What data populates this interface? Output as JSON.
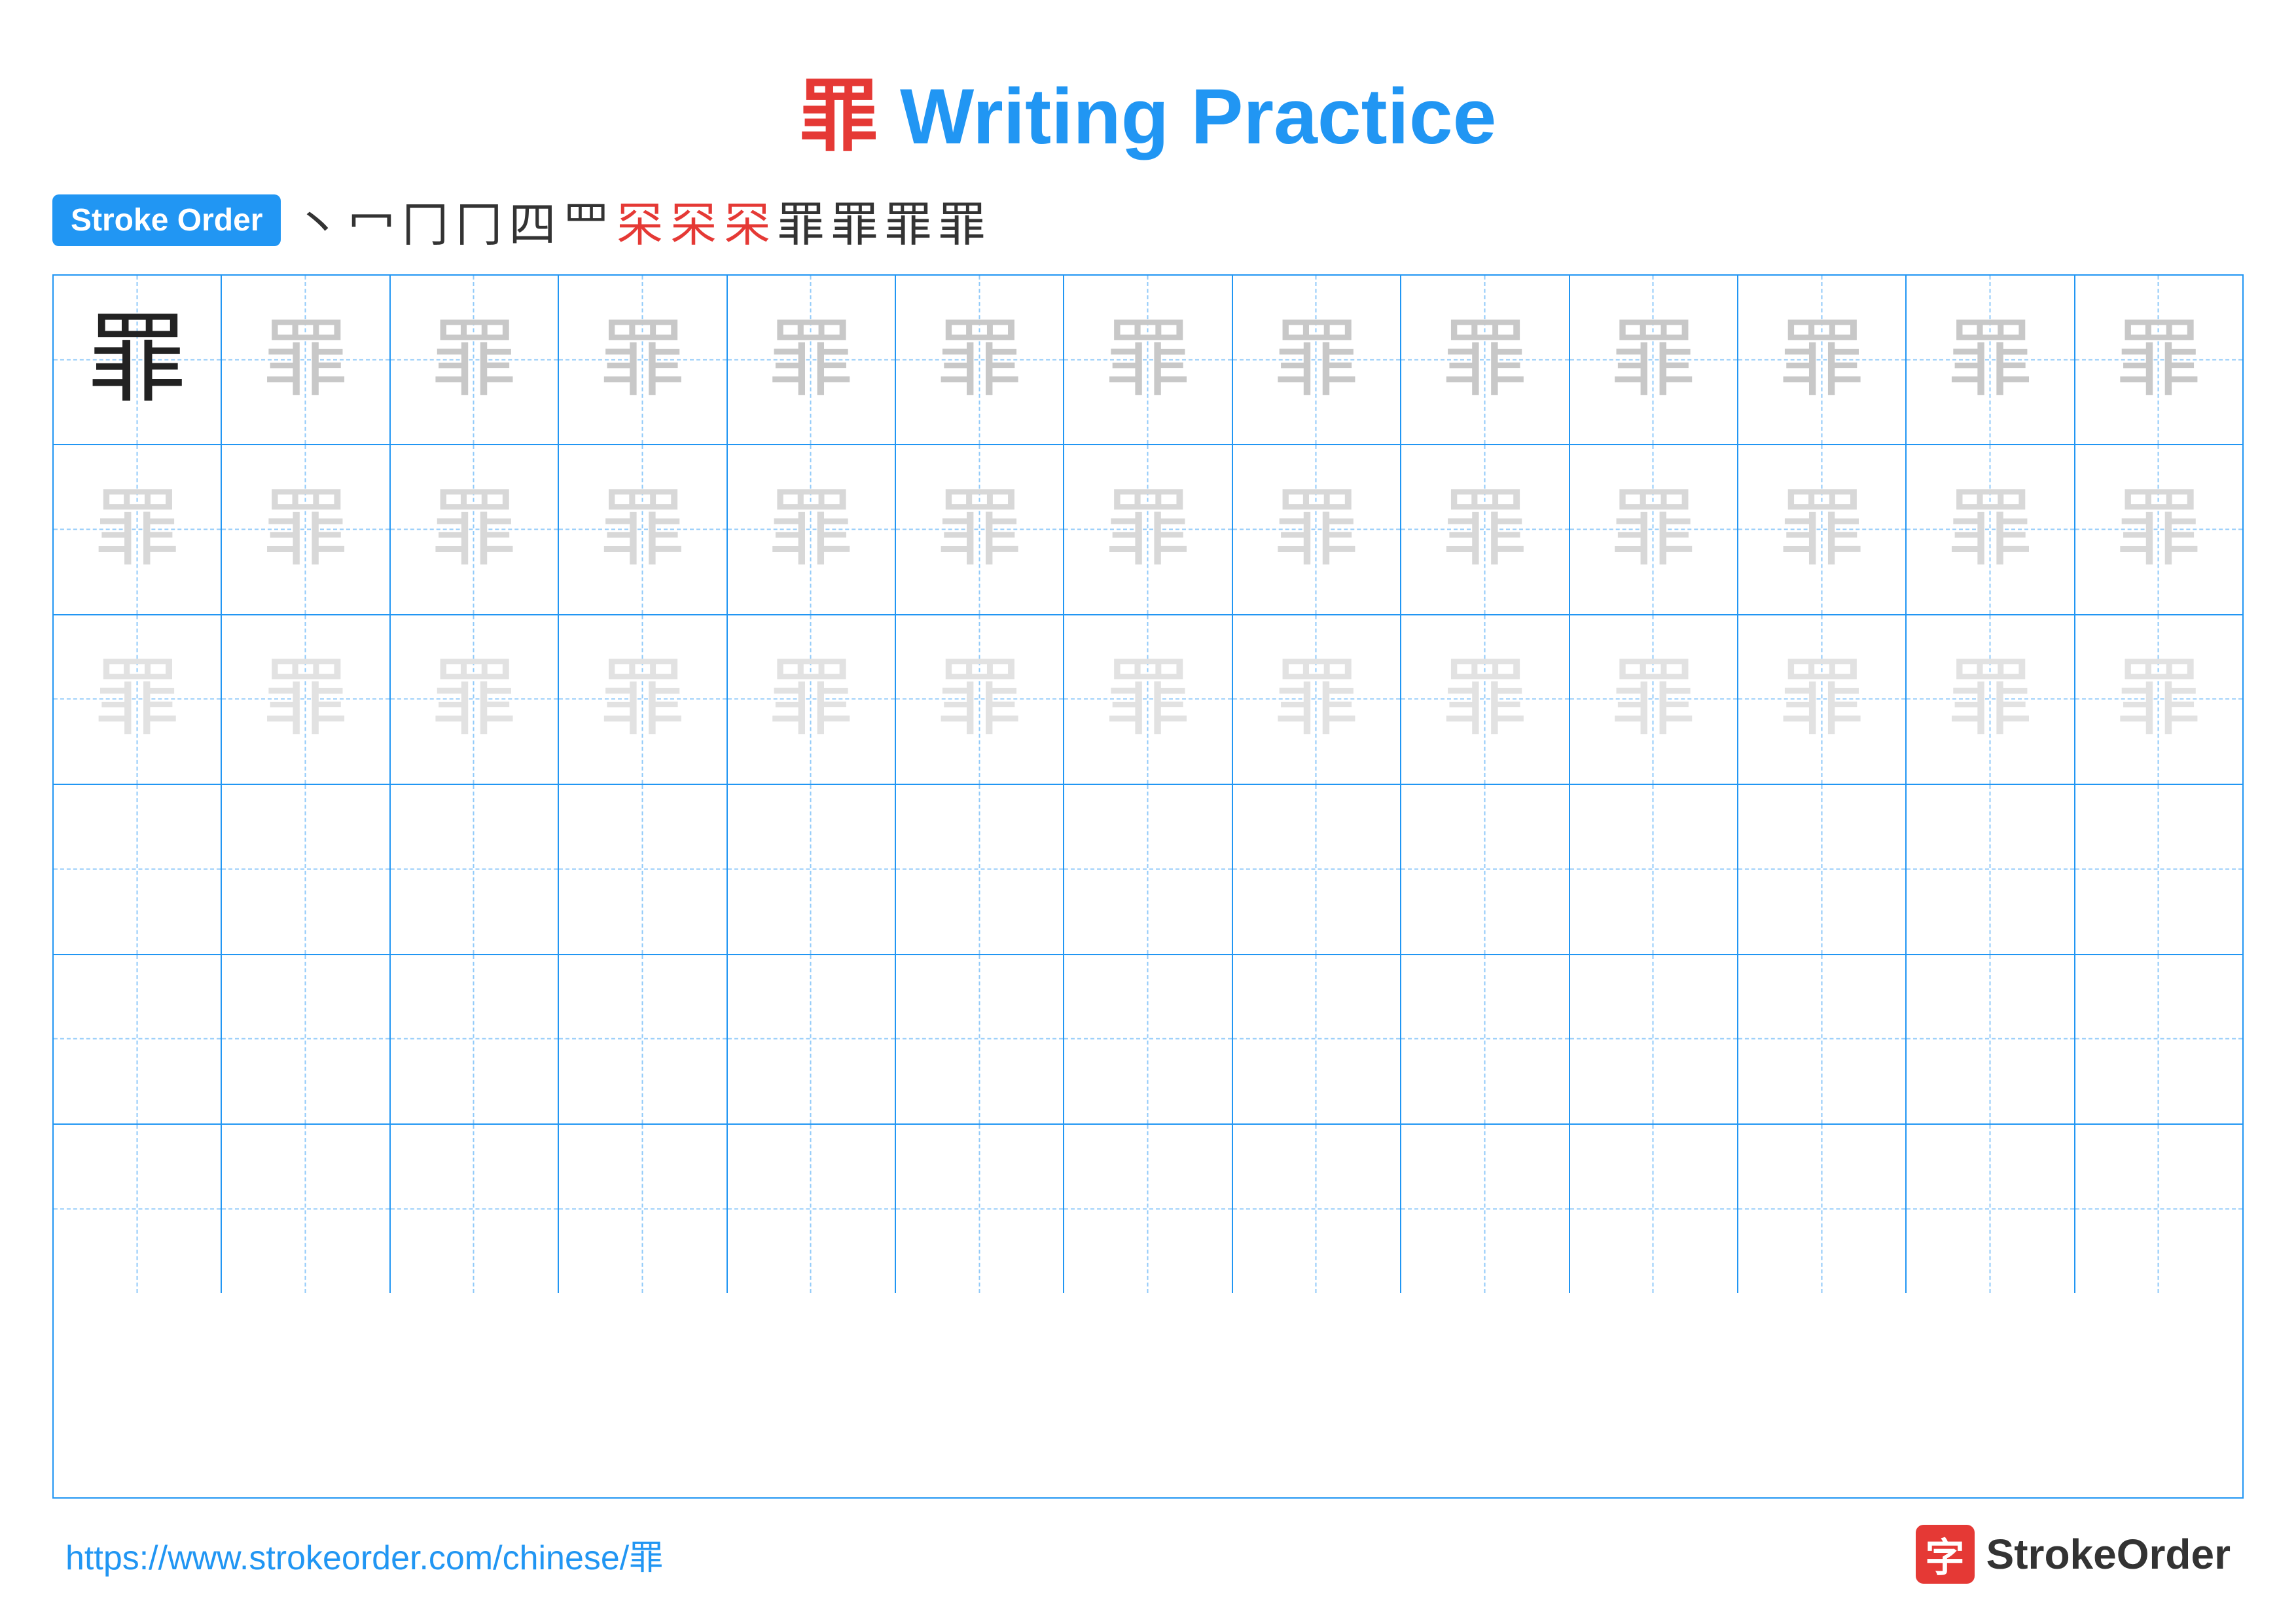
{
  "title": {
    "character": "罪",
    "text": " Writing Practice"
  },
  "stroke_order": {
    "badge_label": "Stroke Order",
    "steps": [
      "丶",
      "冖",
      "冂",
      "冂",
      "四",
      "罒",
      "罙",
      "罙",
      "罙",
      "罪",
      "罪",
      "罪",
      "罪"
    ]
  },
  "grid": {
    "rows": 6,
    "cols": 13,
    "char": "罪",
    "filled_rows": 3
  },
  "footer": {
    "url": "https://www.strokeorder.com/chinese/罪",
    "brand": "StrokeOrder",
    "brand_char": "字"
  }
}
